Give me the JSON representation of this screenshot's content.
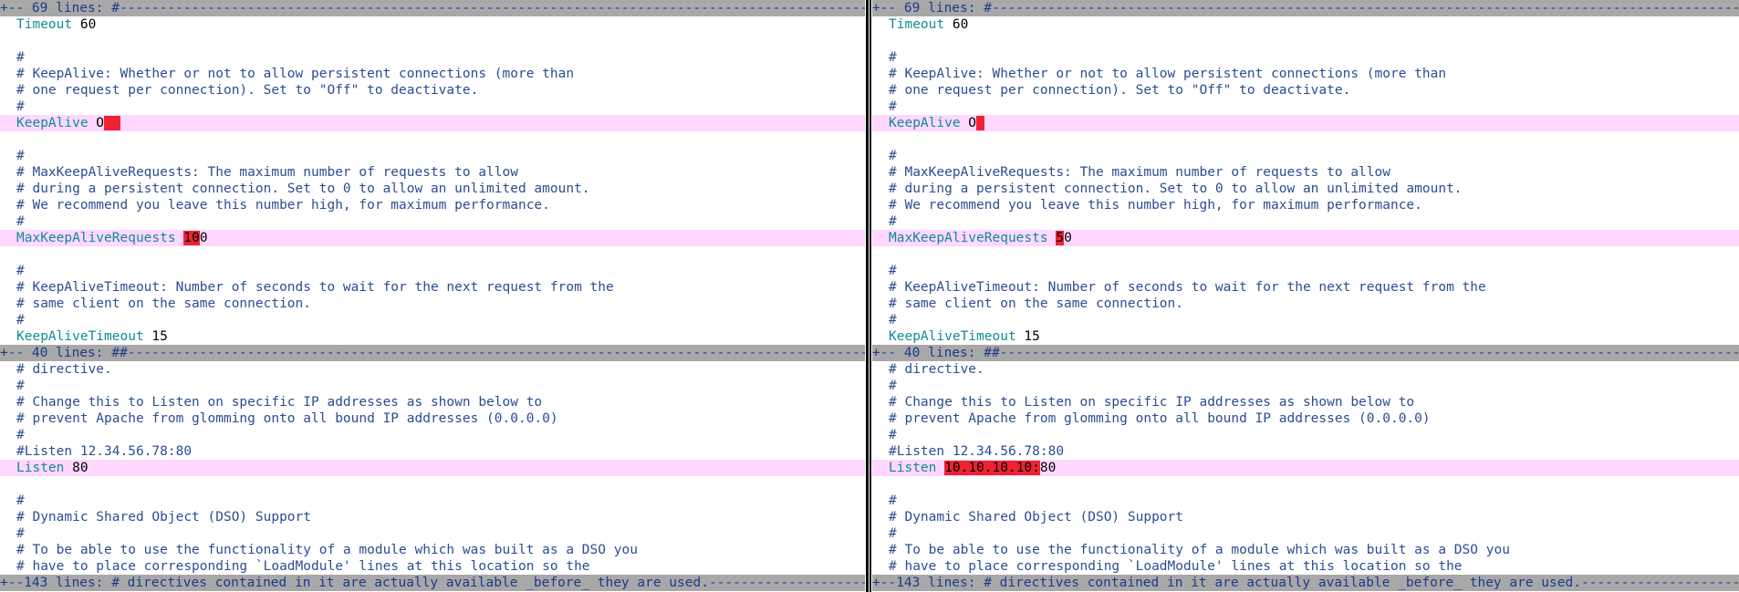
{
  "colors": {
    "background": "#ffffff",
    "fold_bg": "#a8a8a8",
    "diff_line_bg": "#ffd7ff",
    "diff_change_bg": "#ee2233",
    "comment": "#2b4d93",
    "keyword": "#108b95",
    "separator": "#000000"
  },
  "left": {
    "fold1": "+-- 69 lines: #----------------------------------------------------------------------------------------------------",
    "timeout_kw": "Timeout",
    "timeout_val": " 60",
    "c_hash": "#",
    "c_keepalive_1": "# KeepAlive: Whether or not to allow persistent connections (more than",
    "c_keepalive_2": "# one request per connection). Set to \"Off\" to deactivate.",
    "keepalive_kw": "KeepAlive",
    "keepalive_val": " O",
    "c_mkar_1": "# MaxKeepAliveRequests: The maximum number of requests to allow",
    "c_mkar_2": "# during a persistent connection. Set to 0 to allow an unlimited amount.",
    "c_mkar_3": "# We recommend you leave this number high, for maximum performance.",
    "mkar_kw": "MaxKeepAliveRequests",
    "mkar_changed": "10",
    "mkar_rest": "0",
    "c_kat_1": "# KeepAliveTimeout: Number of seconds to wait for the next request from the",
    "c_kat_2": "# same client on the same connection.",
    "kat_kw": "KeepAliveTimeout",
    "kat_val": " 15",
    "fold2": "+-- 40 lines: ##---------------------------------------------------------------------------------------------------",
    "c_directive": "# directive.",
    "c_listen_1": "# Change this to Listen on specific IP addresses as shown below to",
    "c_listen_2": "# prevent Apache from glomming onto all bound IP addresses (0.0.0.0)",
    "c_listen_ex": "#Listen 12.34.56.78:80",
    "listen_kw": "Listen",
    "listen_val": " 80",
    "c_dso": "# Dynamic Shared Object (DSO) Support",
    "c_dso_1": "# To be able to use the functionality of a module which was built as a DSO you",
    "c_dso_2": "# have to place corresponding `LoadModule' lines at this location so the",
    "fold3": "+--143 lines: # directives contained in it are actually available _before_ they are used.-----------------------"
  },
  "right": {
    "fold1": "+-- 69 lines: #----------------------------------------------------------------------------------------------------",
    "timeout_kw": "Timeout",
    "timeout_val": " 60",
    "c_hash": "#",
    "c_keepalive_1": "# KeepAlive: Whether or not to allow persistent connections (more than",
    "c_keepalive_2": "# one request per connection). Set to \"Off\" to deactivate.",
    "keepalive_kw": "KeepAlive",
    "keepalive_val": " O",
    "c_mkar_1": "# MaxKeepAliveRequests: The maximum number of requests to allow",
    "c_mkar_2": "# during a persistent connection. Set to 0 to allow an unlimited amount.",
    "c_mkar_3": "# We recommend you leave this number high, for maximum performance.",
    "mkar_kw": "MaxKeepAliveRequests",
    "mkar_changed": "5",
    "mkar_rest": "0",
    "c_kat_1": "# KeepAliveTimeout: Number of seconds to wait for the next request from the",
    "c_kat_2": "# same client on the same connection.",
    "kat_kw": "KeepAliveTimeout",
    "kat_val": " 15",
    "fold2": "+-- 40 lines: ##---------------------------------------------------------------------------------------------------",
    "c_directive": "# directive.",
    "c_listen_1": "# Change this to Listen on specific IP addresses as shown below to",
    "c_listen_2": "# prevent Apache from glomming onto all bound IP addresses (0.0.0.0)",
    "c_listen_ex": "#Listen 12.34.56.78:80",
    "listen_kw": "Listen",
    "listen_changed": "10.10.10.10:",
    "listen_val": "80",
    "c_dso": "# Dynamic Shared Object (DSO) Support",
    "c_dso_1": "# To be able to use the functionality of a module which was built as a DSO you",
    "c_dso_2": "# have to place corresponding `LoadModule' lines at this location so the",
    "fold3": "+--143 lines: # directives contained in it are actually available _before_ they are used.-----------------------"
  }
}
